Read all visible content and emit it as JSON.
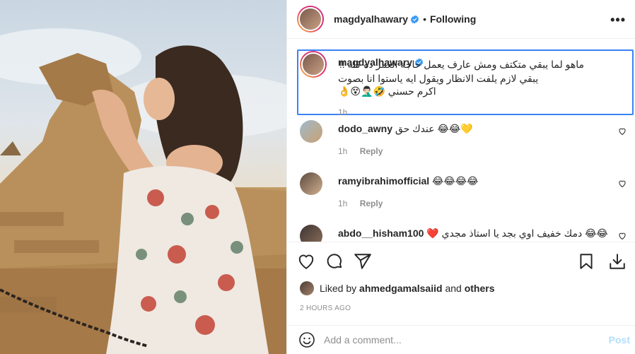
{
  "post": {
    "username": "magdyalhawary",
    "follow_status": "Following",
    "separator": "•",
    "more": "•••"
  },
  "caption": {
    "username": "magdyalhawary",
    "text_line1": "ماهو لما يبقي متكتف ومش عارف يعمل حاجة العمر ده كله !!",
    "text_line2": "يبقي لازم يلفت الانظار ويقول ايه ياستوا انا بصوت اكرم حسني 🤣🤦🏻‍♂️😵👌",
    "time": "1h"
  },
  "comments": [
    {
      "username": "dodo_awny",
      "text": "عندك حق 😂😂💛",
      "time": "1h",
      "reply": "Reply"
    },
    {
      "username": "ramyibrahimofficial",
      "text": "😂😂😂😂",
      "time": "1h",
      "reply": "Reply"
    },
    {
      "username": "abdo__hisham100",
      "text": "❤️ دمك خفيف اوي بجد يا استاذ مجدي 😂😂"
    }
  ],
  "likes": {
    "prefix": "Liked by",
    "user": "ahmedgamalsaiid",
    "conj": "and",
    "suffix": "others"
  },
  "timestamp": "2 HOURS AGO",
  "add_comment": {
    "placeholder": "Add a comment...",
    "post_label": "Post"
  },
  "colors": {
    "verified": "#3897f0",
    "highlight_border": "#3b82f6",
    "post_button": "#b2dffc",
    "muted": "#8e8e8e"
  },
  "icons": [
    "verified-badge-icon",
    "more-options-icon",
    "heart-icon",
    "comment-icon",
    "share-icon",
    "bookmark-icon",
    "download-icon",
    "emoji-icon"
  ]
}
